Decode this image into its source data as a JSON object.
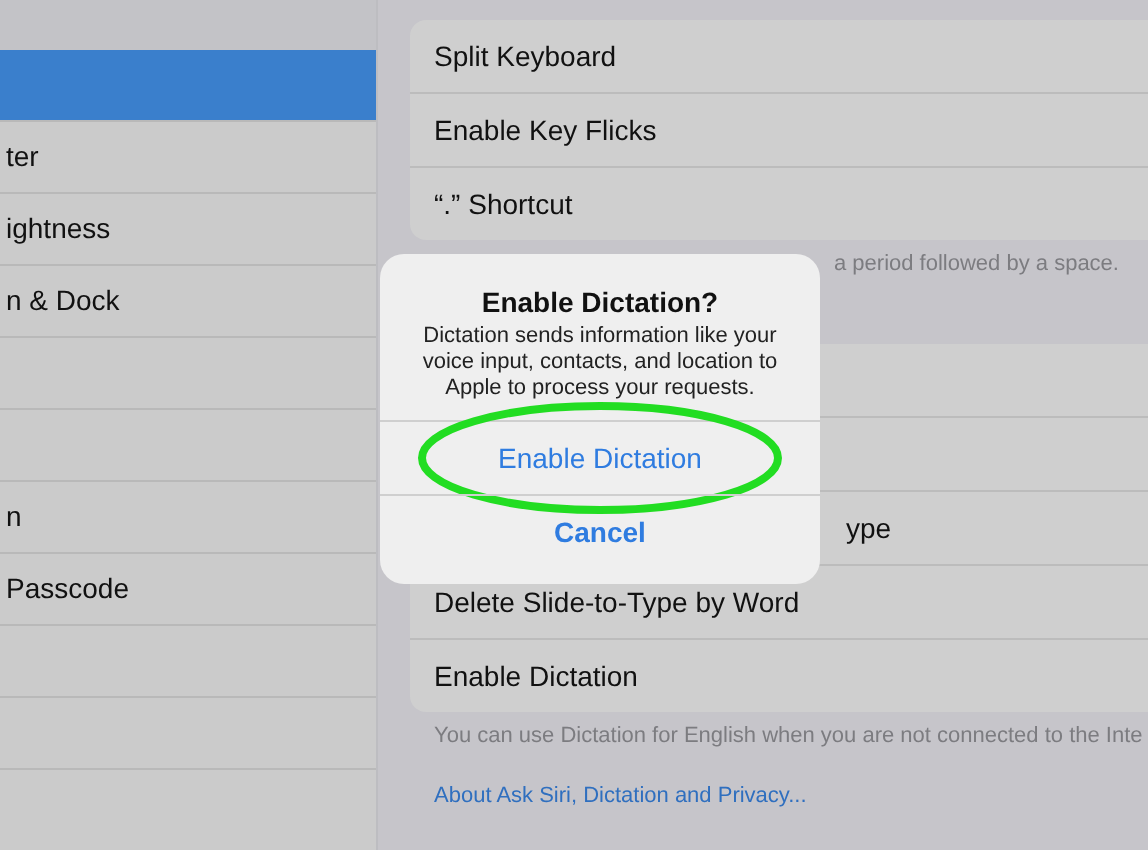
{
  "sidebar": {
    "items": [
      {
        "selected": true
      },
      {
        "label": "ter",
        "selected": false
      },
      {
        "label": "ightness",
        "selected": false
      },
      {
        "label": "n & Dock",
        "selected": false
      },
      {
        "selected": false
      },
      {
        "selected": false
      },
      {
        "label": "n",
        "selected": false
      },
      {
        "label": "Passcode",
        "selected": false
      },
      {
        "selected": false
      },
      {
        "selected": false
      }
    ]
  },
  "settings": {
    "group_1": {
      "rows": [
        "Split Keyboard",
        "Enable Key Flicks",
        "“.” Shortcut"
      ],
      "footer": "a period followed by a space."
    },
    "group_2": {
      "rows": [
        "",
        "",
        "ype",
        "Delete Slide-to-Type by Word",
        "Enable Dictation"
      ],
      "footer": "You can use Dictation for English when you are not connected to the Inte",
      "link": "About Ask Siri, Dictation and Privacy..."
    }
  },
  "dialog": {
    "title": "Enable Dictation?",
    "message": "Dictation sends information like your voice input, contacts, and location to Apple to process your requests.",
    "buttons": [
      {
        "label": "Enable Dictation",
        "highlighted": true,
        "bold": false
      },
      {
        "label": "Cancel",
        "highlighted": false,
        "bold": true
      }
    ]
  }
}
